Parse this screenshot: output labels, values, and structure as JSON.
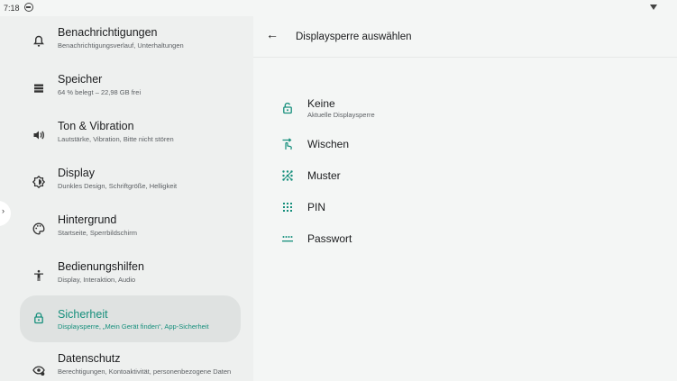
{
  "status_bar": {
    "time": "7:18"
  },
  "sidebar": {
    "items": [
      {
        "title": "Benachrichtigungen",
        "subtitle": "Benachrichtigungsverlauf, Unterhaltungen",
        "icon": "bell-icon"
      },
      {
        "title": "Speicher",
        "subtitle": "64 % belegt – 22,98 GB frei",
        "icon": "storage-icon"
      },
      {
        "title": "Ton & Vibration",
        "subtitle": "Lautstärke, Vibration, Bitte nicht stören",
        "icon": "volume-icon"
      },
      {
        "title": "Display",
        "subtitle": "Dunkles Design, Schriftgröße, Helligkeit",
        "icon": "brightness-icon"
      },
      {
        "title": "Hintergrund",
        "subtitle": "Startseite, Sperrbildschirm",
        "icon": "palette-icon"
      },
      {
        "title": "Bedienungshilfen",
        "subtitle": "Display, Interaktion, Audio",
        "icon": "accessibility-icon"
      },
      {
        "title": "Sicherheit",
        "subtitle": "Displaysperre, „Mein Gerät finden“, App-Sicherheit",
        "icon": "lock-icon",
        "active": true
      },
      {
        "title": "Datenschutz",
        "subtitle": "Berechtigungen, Kontoaktivität, personenbezogene Daten",
        "icon": "privacy-icon"
      }
    ],
    "accent_color": "#168f7c"
  },
  "detail": {
    "title": "Displaysperre auswählen",
    "options": [
      {
        "label": "Keine",
        "subtitle": "Aktuelle Displaysperre",
        "icon": "unlock-icon"
      },
      {
        "label": "Wischen",
        "subtitle": "",
        "icon": "swipe-icon"
      },
      {
        "label": "Muster",
        "subtitle": "",
        "icon": "pattern-icon"
      },
      {
        "label": "PIN",
        "subtitle": "",
        "icon": "pin-icon"
      },
      {
        "label": "Passwort",
        "subtitle": "",
        "icon": "password-icon"
      }
    ]
  }
}
